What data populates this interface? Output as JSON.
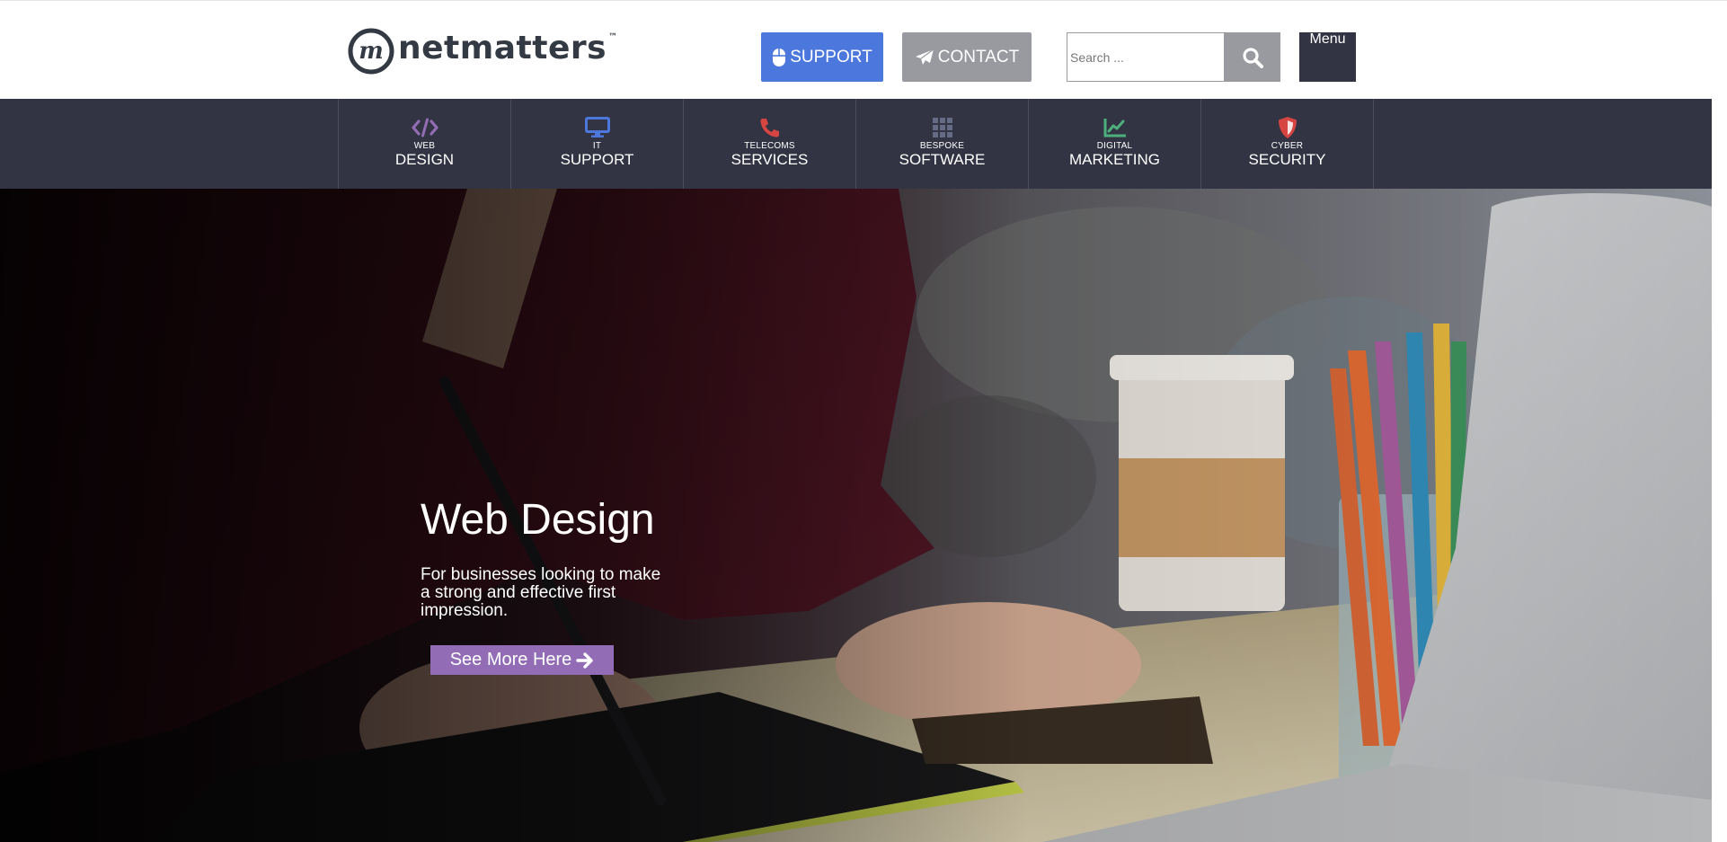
{
  "header": {
    "logo": {
      "text": "netmatters",
      "trademark": "™",
      "icon": "netmatters-logo-icon"
    },
    "support_button": {
      "label": "SUPPORT",
      "icon": "mouse-icon",
      "color": "#4c78dd"
    },
    "contact_button": {
      "label": "CONTACT",
      "icon": "paper-plane-icon",
      "color": "#999aa0"
    },
    "search": {
      "placeholder": "Search ...",
      "value": "",
      "icon": "search-icon"
    },
    "menu_button": {
      "label": "Menu",
      "color": "#333443"
    }
  },
  "nav": {
    "background": "#333443",
    "items": [
      {
        "small": "WEB",
        "label": "DESIGN",
        "icon": "code-icon",
        "icon_color": "#926db5"
      },
      {
        "small": "IT",
        "label": "SUPPORT",
        "icon": "desktop-icon",
        "icon_color": "#4c78dd"
      },
      {
        "small": "TELECOMS",
        "label": "SERVICES",
        "icon": "phone-icon",
        "icon_color": "#d64541"
      },
      {
        "small": "BESPOKE",
        "label": "SOFTWARE",
        "icon": "grid-icon",
        "icon_color": "#666b85"
      },
      {
        "small": "DIGITAL",
        "label": "MARKETING",
        "icon": "chart-line-icon",
        "icon_color": "#4daf7c"
      },
      {
        "small": "CYBER",
        "label": "SECURITY",
        "icon": "shield-icon",
        "icon_color": "#d64541"
      }
    ]
  },
  "hero": {
    "title": "Web Design",
    "subtitle": "For businesses looking to make a strong and effective first impression.",
    "button_label": "See More Here",
    "button_icon": "arrow-right-icon",
    "button_color": "#926db5"
  }
}
